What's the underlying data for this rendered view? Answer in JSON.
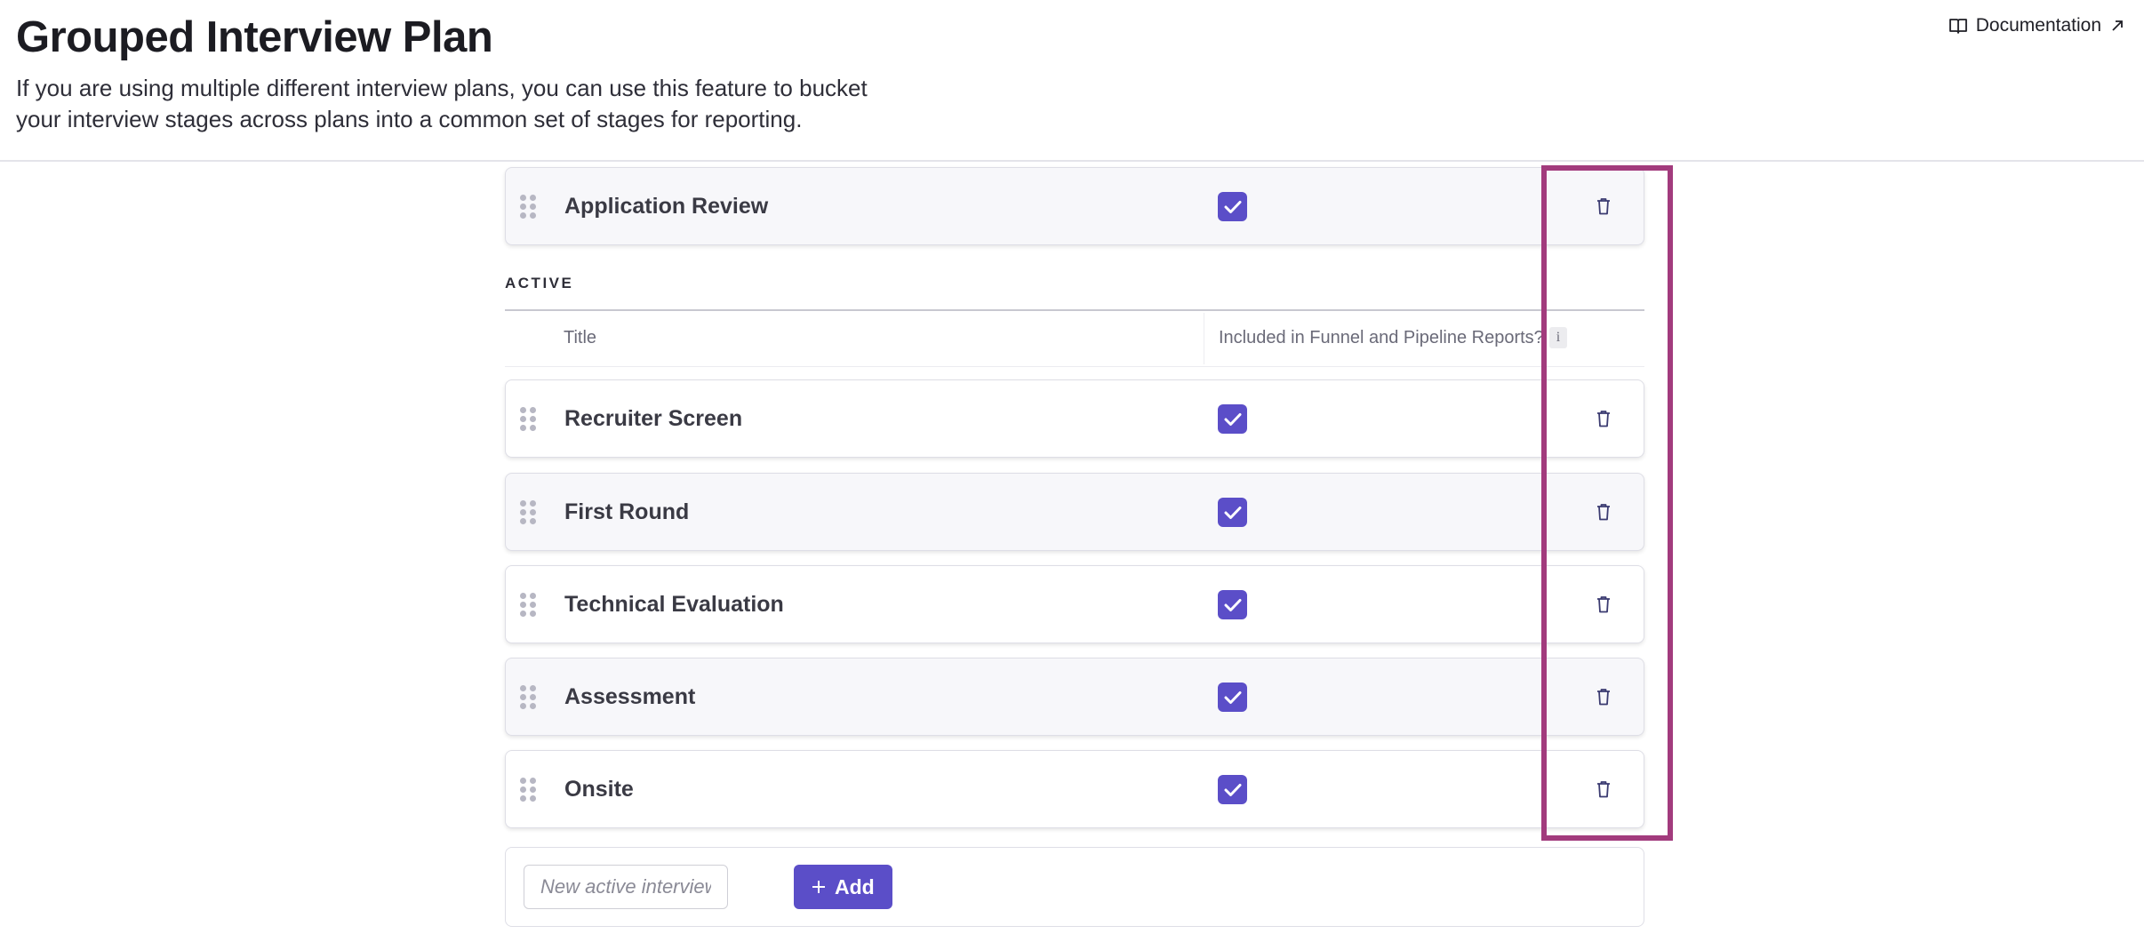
{
  "header": {
    "title": "Grouped Interview Plan",
    "description": "If you are using multiple different interview plans, you can use this feature to bucket your interview stages across plans into a common set of stages for reporting.",
    "documentation_label": "Documentation"
  },
  "top_stage": {
    "title": "Application Review",
    "included": true
  },
  "active_section": {
    "label": "ACTIVE",
    "columns": {
      "title": "Title",
      "included": "Included in Funnel and Pipeline Reports?",
      "info": "i"
    },
    "stages": [
      {
        "title": "Recruiter Screen",
        "included": true
      },
      {
        "title": "First Round",
        "included": true
      },
      {
        "title": "Technical Evaluation",
        "included": true
      },
      {
        "title": "Assessment",
        "included": true
      },
      {
        "title": "Onsite",
        "included": true
      }
    ]
  },
  "add_form": {
    "placeholder": "New active interview stage",
    "button_label": "Add"
  },
  "colors": {
    "accent": "#5b4ec8",
    "highlight": "#a23b7d",
    "row_alt_bg": "#f7f7fa"
  }
}
